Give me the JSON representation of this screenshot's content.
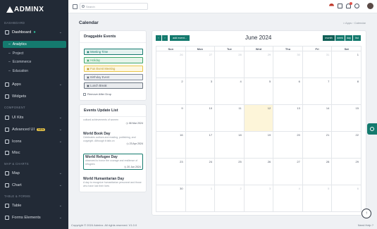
{
  "brand": {
    "logo_text": "ADMINX"
  },
  "sidebar": {
    "sections": [
      "DASHBOARD",
      "COMPONENT",
      "MAP & CHARTS",
      "TABLE & FORMS"
    ],
    "dashboard_label": "Dashboard",
    "sub_items": [
      "Analytics",
      "Project",
      "Ecommerce",
      "Education"
    ],
    "items": [
      {
        "label": "Apps"
      },
      {
        "label": "Widgets"
      },
      {
        "label": "UI Kits"
      },
      {
        "label": "Advanced UI",
        "badge": "NEW"
      },
      {
        "label": "Icons"
      },
      {
        "label": "Misc"
      },
      {
        "label": "Map"
      },
      {
        "label": "Chart"
      },
      {
        "label": "Table"
      },
      {
        "label": "Forms Elements"
      }
    ]
  },
  "topbar": {
    "search_placeholder": "Search"
  },
  "page": {
    "title": "Calendar",
    "breadcrumb_home": "Apps",
    "breadcrumb_sep": "›",
    "breadcrumb_current": "Calendar"
  },
  "draggable": {
    "title": "Draggable Events",
    "events": [
      {
        "label": "Meeting Time",
        "color": "#147a6e"
      },
      {
        "label": "Holiday",
        "color": "#3fa66a"
      },
      {
        "label": "Fun Event Meeting",
        "color": "#e8c64a"
      },
      {
        "label": "Birthday Event",
        "color": "#7d8796"
      },
      {
        "label": "Lunch Break",
        "color": "#6b7481"
      }
    ],
    "remove_after_drop": "Remove After Drop"
  },
  "updates": {
    "title": "Events Update List",
    "items": [
      {
        "desc": "cultural achievements of women",
        "date": "08 Mar 2024"
      },
      {
        "title": "World Book Day",
        "desc": "Celebrates authors and reading, publishing, and copyright. Although it falls on",
        "date": "23 Apr 2024"
      },
      {
        "title": "World Refugee Day",
        "desc": "observed to honor the courage and resilience of refugees",
        "date": "20 Jun 2024"
      },
      {
        "title": "World Humanitarian Day",
        "desc": "A day to recognize humanitarian personnel and those who have lost their lives"
      }
    ]
  },
  "calendar": {
    "month_title": "June 2024",
    "prev": "‹",
    "next": "›",
    "add_event": "add event...",
    "views": [
      "month",
      "week",
      "day",
      "list"
    ],
    "weekdays": [
      "Sun",
      "Mon",
      "Tue",
      "Wed",
      "Thu",
      "Fri",
      "Sat"
    ],
    "weeks": [
      [
        "26",
        "27",
        "28",
        "29",
        "30",
        "31",
        "1"
      ],
      [
        "2",
        "3",
        "4",
        "5",
        "6",
        "7",
        "8"
      ],
      [
        "9",
        "10",
        "11",
        "12",
        "13",
        "14",
        "15"
      ],
      [
        "16",
        "17",
        "18",
        "19",
        "20",
        "21",
        "22"
      ],
      [
        "23",
        "24",
        "25",
        "26",
        "27",
        "28",
        "29"
      ],
      [
        "30",
        "1",
        "2",
        "3",
        "4",
        "5",
        "6"
      ]
    ],
    "today_label": "12"
  },
  "footer": {
    "copyright": "Copyright © 2024 Adminx. All rights reserved. V1.0.0",
    "help": "Need Help ?"
  }
}
